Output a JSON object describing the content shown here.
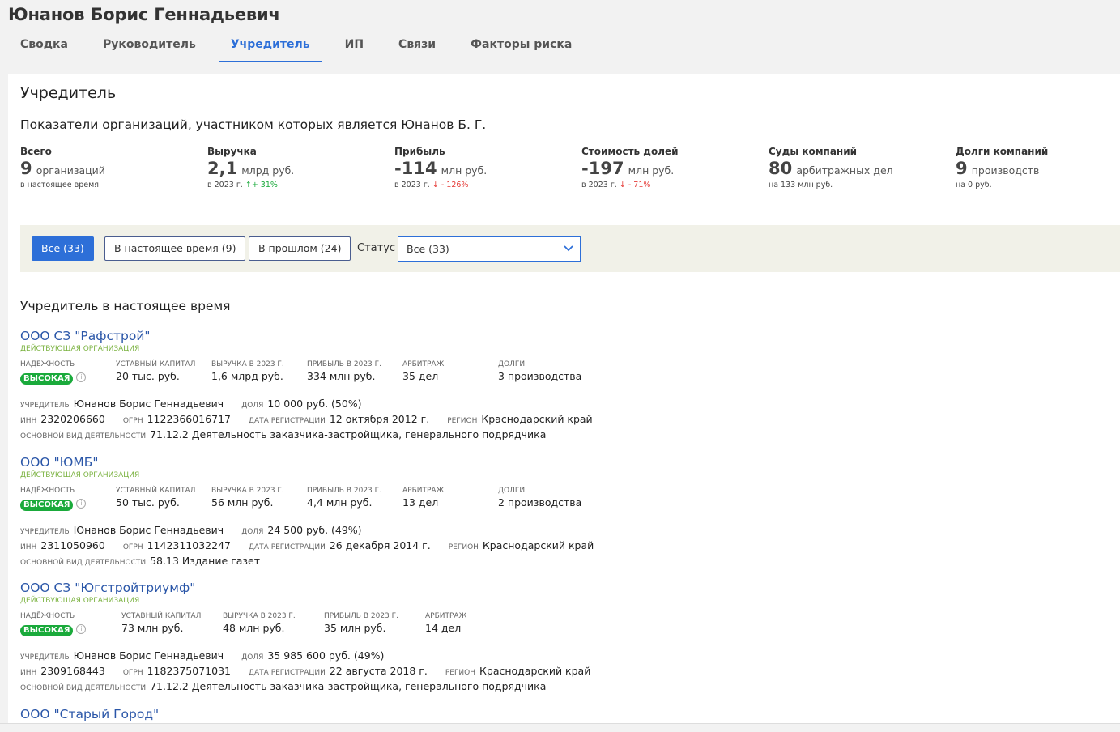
{
  "page": {
    "title": "Юнанов Борис Геннадьевич"
  },
  "tabs": [
    "Сводка",
    "Руководитель",
    "Учредитель",
    "ИП",
    "Связи",
    "Факторы риска"
  ],
  "active_tab": "Учредитель",
  "section": {
    "heading": "Учредитель",
    "subtitle": "Показатели организаций, участником которых является Юнанов Б. Г."
  },
  "stats": [
    {
      "label": "Всего",
      "value": "9",
      "unit": "организаций",
      "sub": "в настоящее время",
      "trend": ""
    },
    {
      "label": "Выручка",
      "value": "2,1",
      "unit": "млрд руб.",
      "sub": "в 2023 г.",
      "trend": "+ 31%",
      "dir": "up"
    },
    {
      "label": "Прибыль",
      "value": "-114",
      "unit": "млн руб.",
      "sub": "в 2023 г.",
      "trend": "- 126%",
      "dir": "down"
    },
    {
      "label": "Стоимость долей",
      "value": "-197",
      "unit": "млн руб.",
      "sub": "в 2023 г.",
      "trend": "- 71%",
      "dir": "down"
    },
    {
      "label": "Суды компаний",
      "value": "80",
      "unit": "арбитражных дел",
      "sub": "на 133 млн руб.",
      "trend": ""
    },
    {
      "label": "Долги компаний",
      "value": "9",
      "unit": "производств",
      "sub": "на 0 руб.",
      "trend": ""
    }
  ],
  "filters": {
    "all": "Все (33)",
    "current": "В настоящее время (9)",
    "past": "В прошлом (24)",
    "status_label": "Статус",
    "status_value": "Все (33)"
  },
  "list_title": "Учредитель в настоящее время",
  "labels": {
    "reliability": "Надёжность",
    "capital": "Уставный капитал",
    "revenue": "Выручка в 2023 г.",
    "profit": "Прибыль в 2023 г.",
    "arbitration": "Арбитраж",
    "debts": "Долги",
    "founder": "Учредитель",
    "share": "Доля",
    "inn": "ИНН",
    "ogrn": "ОГРН",
    "reg_date": "Дата регистрации",
    "region": "Регион",
    "activity": "Основной вид деятельности"
  },
  "orgs": [
    {
      "name": "ООО СЗ \"Рафстрой\"",
      "status": "Действующая организация",
      "reliability": "ВЫСОКАЯ",
      "capital": "20 тыс. руб.",
      "revenue": "1,6 млрд руб.",
      "profit": "334 млн руб.",
      "arbitration": "35 дел",
      "debts": "3 производства",
      "founder": "Юнанов Борис Геннадьевич",
      "share": "10 000 руб. (50%)",
      "inn": "2320206660",
      "ogrn": "1122366016717",
      "reg_date": "12 октября 2012 г.",
      "region": "Краснодарский край",
      "activity": "71.12.2 Деятельность заказчика-застройщика, генерального подрядчика"
    },
    {
      "name": "ООО \"ЮМБ\"",
      "status": "Действующая организация",
      "reliability": "ВЫСОКАЯ",
      "capital": "50 тыс. руб.",
      "revenue": "56 млн руб.",
      "profit": "4,4 млн руб.",
      "arbitration": "13 дел",
      "debts": "2 производства",
      "founder": "Юнанов Борис Геннадьевич",
      "share": "24 500 руб. (49%)",
      "inn": "2311050960",
      "ogrn": "1142311032247",
      "reg_date": "26 декабря 2014 г.",
      "region": "Краснодарский край",
      "activity": "58.13 Издание газет"
    },
    {
      "name": "ООО СЗ \"Югстройтриумф\"",
      "status": "Действующая организация",
      "reliability": "ВЫСОКАЯ",
      "capital": "73 млн руб.",
      "revenue": "48 млн руб.",
      "profit": "35 млн руб.",
      "arbitration": "14 дел",
      "founder": "Юнанов Борис Геннадьевич",
      "share": "35 985 600 руб. (49%)",
      "inn": "2309168443",
      "ogrn": "1182375071031",
      "reg_date": "22 августа 2018 г.",
      "region": "Краснодарский край",
      "activity": "71.12.2 Деятельность заказчика-застройщика, генерального подрядчика"
    },
    {
      "name": "ООО \"Старый Город\""
    }
  ],
  "colors": {
    "accent": "#2d6fd8",
    "badge": "#1aaa3b",
    "up": "#1aaa3b",
    "down": "#e53935",
    "link": "#2a56a8",
    "status": "#7cb342"
  }
}
